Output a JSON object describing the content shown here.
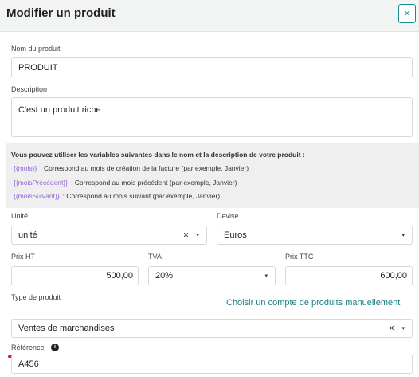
{
  "header": {
    "title": "Modifier un produit",
    "close_label": "×"
  },
  "product_name": {
    "label": "Nom du produit",
    "value": "PRODUIT"
  },
  "description": {
    "label": "Description",
    "value": "C'est un produit riche"
  },
  "variables_info": {
    "title": "Vous pouvez utiliser les variables suivantes dans le nom et la description de votre produit :",
    "items": [
      {
        "variable": "{{mois}}",
        "description": ": Correspond au mois de création de la facture (par exemple, Janvier)"
      },
      {
        "variable": "{{moisPrécédent}}",
        "description": ": Correspond au mois précédent (par exemple, Janvier)"
      },
      {
        "variable": "{{moisSuivant}}",
        "description": ": Correspond au mois suivant (par exemple, Janvier)"
      }
    ]
  },
  "unit": {
    "label": "Unité",
    "value": "unité"
  },
  "currency": {
    "label": "Devise",
    "value": "Euros"
  },
  "price_ht": {
    "label": "Prix HT",
    "value": "500,00"
  },
  "tva": {
    "label": "TVA",
    "value": "20%"
  },
  "price_ttc": {
    "label": "Prix TTC",
    "value": "600,00"
  },
  "product_type": {
    "label": "Type de produit",
    "link": "Choisir un compte de produits manuellement",
    "value": "Ventes de marchandises"
  },
  "reference": {
    "label": "Référence",
    "value": "A456",
    "info_icon": "i"
  },
  "icons": {
    "caret": "▾",
    "clear": "×"
  },
  "colors": {
    "accent": "#1a7f80",
    "variable": "#9366d6",
    "error_underline": "#d01f1f"
  }
}
